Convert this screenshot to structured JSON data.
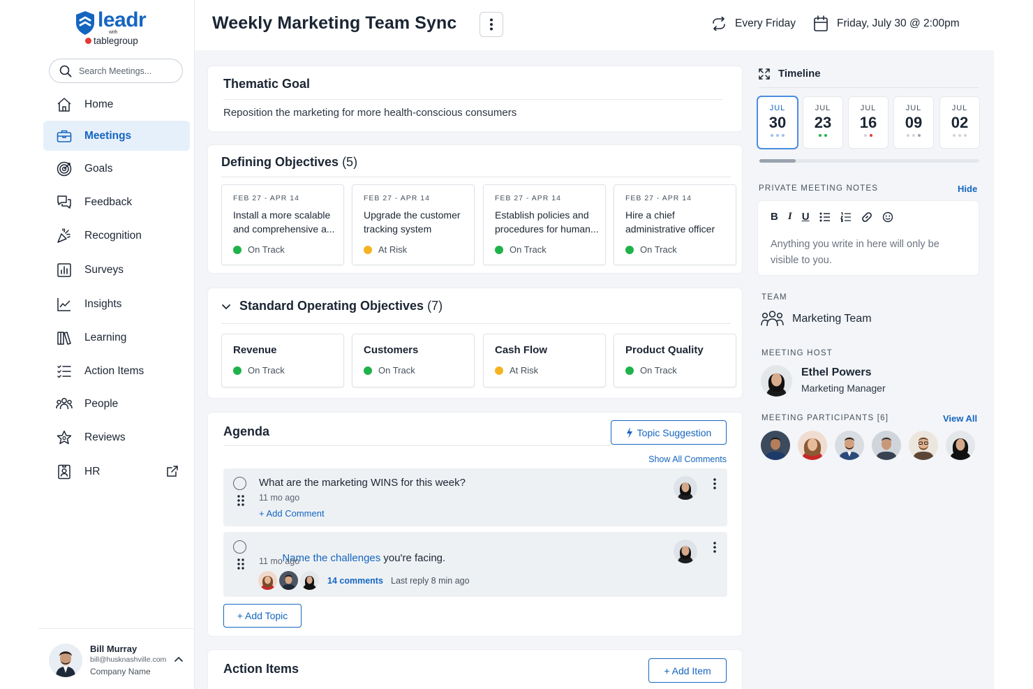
{
  "brand": {
    "logo_text": "leadr",
    "logo_with": "with",
    "logo_partner": "tablegroup"
  },
  "search": {
    "placeholder": "Search Meetings..."
  },
  "nav": [
    {
      "label": "Home",
      "icon": "home-icon"
    },
    {
      "label": "Meetings",
      "icon": "briefcase-icon",
      "active": true
    },
    {
      "label": "Goals",
      "icon": "target-icon"
    },
    {
      "label": "Feedback",
      "icon": "chat-bubbles-icon"
    },
    {
      "label": "Recognition",
      "icon": "party-popper-icon"
    },
    {
      "label": "Surveys",
      "icon": "bar-chart-icon"
    },
    {
      "label": "Insights",
      "icon": "line-chart-icon"
    },
    {
      "label": "Learning",
      "icon": "books-icon"
    },
    {
      "label": "Action Items",
      "icon": "checklist-icon"
    },
    {
      "label": "People",
      "icon": "people-icon"
    },
    {
      "label": "Reviews",
      "icon": "star-icon"
    },
    {
      "label": "HR",
      "icon": "id-badge-icon",
      "external": true
    }
  ],
  "user": {
    "name": "Bill Murray",
    "email": "bill@husknashville.com",
    "company": "Company Name"
  },
  "header": {
    "title": "Weekly Marketing Team Sync",
    "recurrence": "Every Friday",
    "datetime": "Friday, July 30 @ 2:00pm"
  },
  "thematic": {
    "title": "Thematic Goal",
    "text": "Reposition the marketing for more health-conscious consumers"
  },
  "defining": {
    "title": "Defining Objectives",
    "count": "(5)",
    "items": [
      {
        "date": "FEB 27 - APR 14",
        "text": "Install a more scalable and comprehensive a...",
        "status": "On Track"
      },
      {
        "date": "FEB 27 - APR 14",
        "text": "Upgrade the customer tracking system",
        "status": "At Risk"
      },
      {
        "date": "FEB 27 - APR 14",
        "text": "Establish policies and procedures for human...",
        "status": "On Track"
      },
      {
        "date": "FEB 27 - APR 14",
        "text": "Hire a chief administrative officer",
        "status": "On Track"
      }
    ]
  },
  "standard": {
    "title": "Standard Operating Objectives",
    "count": "(7)",
    "items": [
      {
        "name": "Revenue",
        "status": "On Track"
      },
      {
        "name": "Customers",
        "status": "On Track"
      },
      {
        "name": "Cash Flow",
        "status": "At Risk"
      },
      {
        "name": "Product Quality",
        "status": "On Track"
      }
    ]
  },
  "agenda": {
    "title": "Agenda",
    "topic_button": "Topic Suggestion",
    "show_all": "Show All Comments",
    "add_topic": "+ Add Topic",
    "items": [
      {
        "text": "What are the marketing WINS for this week?",
        "time": "11 mo ago",
        "add_comment": "+ Add Comment"
      },
      {
        "text_link": "Name the challenges",
        "text_rest": " you're facing.",
        "time": "11 mo ago",
        "comments": "14 comments",
        "last_reply": "Last reply 8 min ago"
      }
    ]
  },
  "action_items": {
    "title": "Action Items",
    "add_button": "+ Add Item"
  },
  "timeline": {
    "title": "Timeline",
    "dates": [
      {
        "month": "JUL",
        "day": "30",
        "selected": true
      },
      {
        "month": "JUL",
        "day": "23"
      },
      {
        "month": "JUL",
        "day": "16"
      },
      {
        "month": "JUL",
        "day": "09"
      },
      {
        "month": "JUL",
        "day": "02"
      }
    ]
  },
  "notes": {
    "label": "PRIVATE MEETING NOTES",
    "hide": "Hide",
    "placeholder": "Anything you write in here will only be visible to you.",
    "toolbar": [
      "B",
      "I",
      "U"
    ]
  },
  "team": {
    "label": "TEAM",
    "name": "Marketing Team"
  },
  "host": {
    "label": "MEETING HOST",
    "name": "Ethel Powers",
    "role": "Marketing Manager"
  },
  "participants": {
    "label": "MEETING PARTICIPANTS [6]",
    "view_all": "View All",
    "count": 6
  },
  "colors": {
    "accent": "#1565c0",
    "on_track": "#1fb24a",
    "at_risk": "#f5b322",
    "active_bg": "#e6f0fb"
  }
}
